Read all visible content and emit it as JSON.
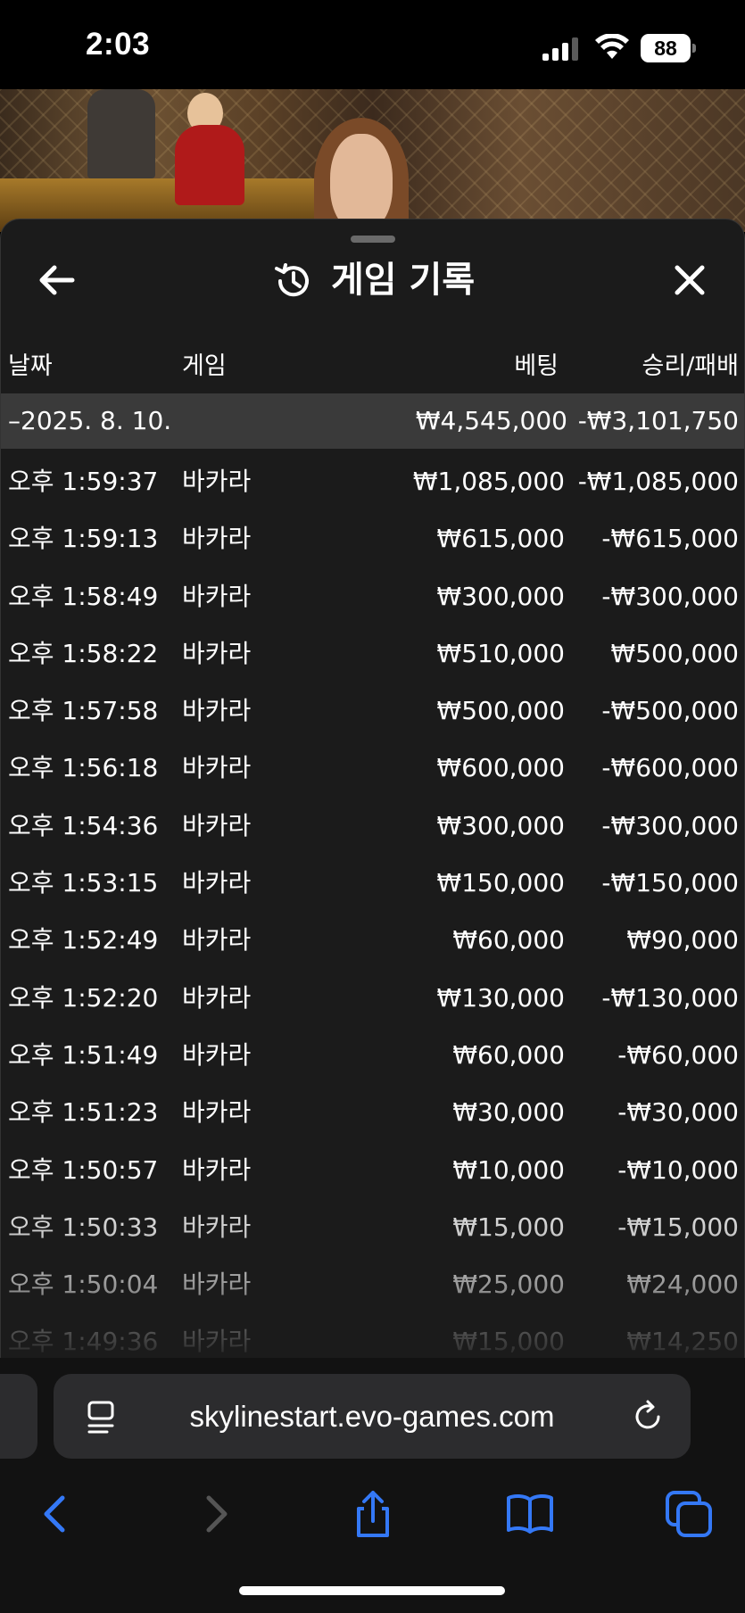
{
  "status": {
    "time": "2:03",
    "battery": "88"
  },
  "sheet": {
    "title": "게임 기록"
  },
  "columns": {
    "date": "날짜",
    "game": "게임",
    "bet": "베팅",
    "result": "승리/패배"
  },
  "date_group": {
    "label": "–2025. 8. 10.",
    "bet": "₩4,545,000",
    "result": "-₩3,101,750"
  },
  "rows": [
    {
      "time": "오후 1:59:37",
      "game": "바카라",
      "bet": "₩1,085,000",
      "result": "-₩1,085,000"
    },
    {
      "time": "오후 1:59:13",
      "game": "바카라",
      "bet": "₩615,000",
      "result": "-₩615,000"
    },
    {
      "time": "오후 1:58:49",
      "game": "바카라",
      "bet": "₩300,000",
      "result": "-₩300,000"
    },
    {
      "time": "오후 1:58:22",
      "game": "바카라",
      "bet": "₩510,000",
      "result": "₩500,000"
    },
    {
      "time": "오후 1:57:58",
      "game": "바카라",
      "bet": "₩500,000",
      "result": "-₩500,000"
    },
    {
      "time": "오후 1:56:18",
      "game": "바카라",
      "bet": "₩600,000",
      "result": "-₩600,000"
    },
    {
      "time": "오후 1:54:36",
      "game": "바카라",
      "bet": "₩300,000",
      "result": "-₩300,000"
    },
    {
      "time": "오후 1:53:15",
      "game": "바카라",
      "bet": "₩150,000",
      "result": "-₩150,000"
    },
    {
      "time": "오후 1:52:49",
      "game": "바카라",
      "bet": "₩60,000",
      "result": "₩90,000"
    },
    {
      "time": "오후 1:52:20",
      "game": "바카라",
      "bet": "₩130,000",
      "result": "-₩130,000"
    },
    {
      "time": "오후 1:51:49",
      "game": "바카라",
      "bet": "₩60,000",
      "result": "-₩60,000"
    },
    {
      "time": "오후 1:51:23",
      "game": "바카라",
      "bet": "₩30,000",
      "result": "-₩30,000"
    },
    {
      "time": "오후 1:50:57",
      "game": "바카라",
      "bet": "₩10,000",
      "result": "-₩10,000"
    },
    {
      "time": "오후 1:50:33",
      "game": "바카라",
      "bet": "₩15,000",
      "result": "-₩15,000"
    },
    {
      "time": "오후 1:50:04",
      "game": "바카라",
      "bet": "₩25,000",
      "result": "₩24,000"
    },
    {
      "time": "오후 1:49:36",
      "game": "바카라",
      "bet": "₩15,000",
      "result": "₩14,250"
    }
  ],
  "browser": {
    "url": "skylinestart.evo-games.com"
  },
  "icons": {
    "back": "arrow-left-icon",
    "close": "close-icon",
    "history": "history-icon",
    "reader": "reader-icon",
    "reload": "reload-icon",
    "nav_back": "chevron-left-icon",
    "nav_forward": "chevron-right-icon",
    "share": "share-icon",
    "bookmarks": "book-icon",
    "tabs": "tabs-icon"
  },
  "colors": {
    "sheet_bg": "#1b1b1b",
    "date_row_bg": "#3a3a3a",
    "accent": "#3478f6"
  }
}
